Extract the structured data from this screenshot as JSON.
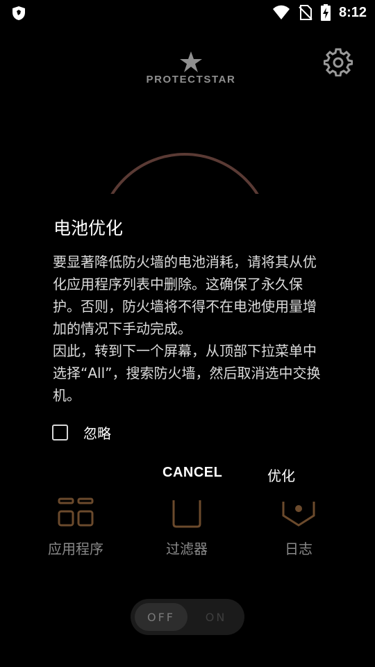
{
  "status_bar": {
    "time": "8:12"
  },
  "app": {
    "brand": "PROTECTSTAR",
    "nav": [
      {
        "label": "应用程序"
      },
      {
        "label": "过滤器"
      },
      {
        "label": "日志"
      }
    ],
    "toggle": {
      "off_label": "OFF",
      "on_label": "ON"
    }
  },
  "dialog": {
    "title": "电池优化",
    "message": "要显著降低防火墙的电池消耗，请将其从优化应用程序列表中删除。这确保了永久保护。否则，防火墙将不得不在电池使用量增加的情况下手动完成。\n因此，转到下一个屏幕，从顶部下拉菜单中选择“All”，搜索防火墙，然后取消选中交换机。",
    "checkbox_label": "忽略",
    "cancel_label": "CANCEL",
    "confirm_label": "优化"
  },
  "colors": {
    "background": "#000000",
    "accent_arc": "#5a3a34",
    "icon_bronze": "#6b4a2c",
    "muted_text": "#8a8a8a"
  },
  "icons": [
    "security-shield-icon",
    "wifi-icon",
    "no-sim-icon",
    "battery-charging-icon",
    "star-logo-icon",
    "gear-icon",
    "apps-grid-icon",
    "filter-icon",
    "log-icon"
  ]
}
